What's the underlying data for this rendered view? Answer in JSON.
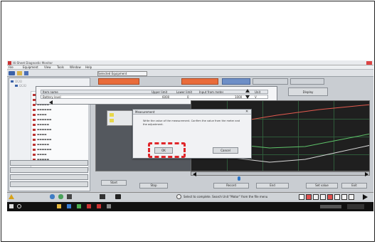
{
  "window": {
    "title": "Hi-Sheet Diagnostic Monitor",
    "menu": [
      "File",
      "Equipment",
      "View",
      "Tools",
      "Window",
      "Help"
    ]
  },
  "header_tab": "Selected Equipment",
  "param_table": {
    "columns": [
      "Item name",
      "Upper limit",
      "Lower limit",
      "Input from meter",
      "Unit"
    ],
    "row": [
      "Battery level",
      "6000",
      "0",
      "1000",
      "V"
    ]
  },
  "top_right_button": "Display",
  "dialog": {
    "title": "Measurement",
    "message": "Write the value of the measurement. Confirm the value from the meter and the adjustment.",
    "ok_label": "OK",
    "cancel_label": "Cancel"
  },
  "bottom_buttons": {
    "start": "Start",
    "stop": "Stop",
    "record": "Record",
    "end": "End",
    "set_value": "Set value",
    "exit": "Exit"
  },
  "status_message": "Select to complete. Search Unit \"Motor\" from the file menu",
  "colors": {
    "highlight": "#e0262a",
    "graph_bg": "#1f1f1f",
    "taskbar": "#111111",
    "orange_tab": "#e96c3b"
  }
}
